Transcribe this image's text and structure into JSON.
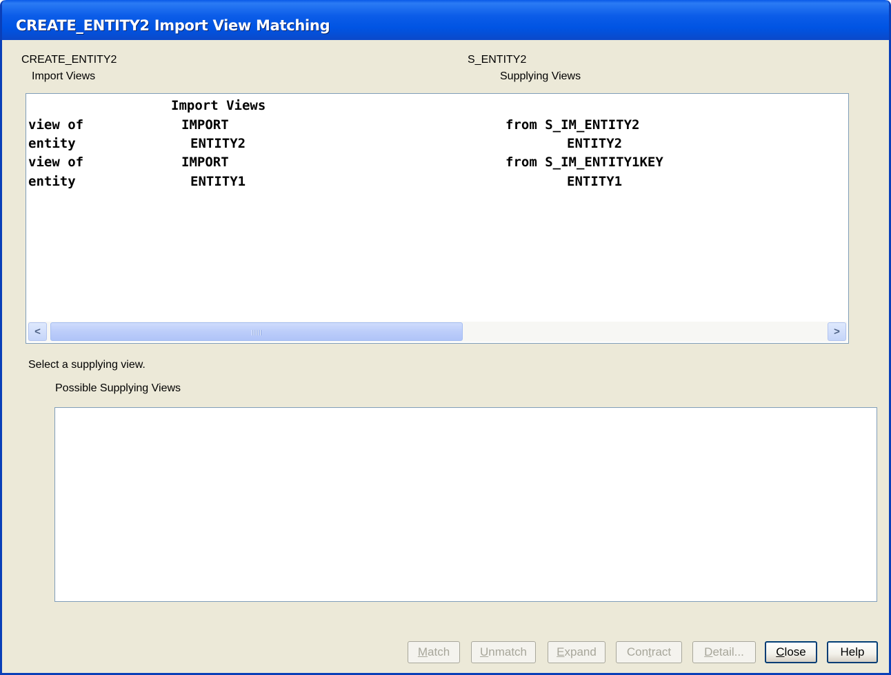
{
  "window": {
    "title": "CREATE_ENTITY2 Import View Matching"
  },
  "header": {
    "left_name": "CREATE_ENTITY2",
    "left_sub": "Import Views",
    "right_name": "S_ENTITY2",
    "right_sub": "Supplying Views"
  },
  "import_view": {
    "heading": "Import Views",
    "rows": [
      {
        "col1": "view of",
        "col2": "IMPORT",
        "col3": "from S_IM_ENTITY2"
      },
      {
        "col1": "entity",
        "col2": "ENTITY2",
        "col3": "ENTITY2"
      },
      {
        "col1": "view of",
        "col2": "IMPORT",
        "col3": "from S_IM_ENTITY1KEY"
      },
      {
        "col1": "entity",
        "col2": "ENTITY1",
        "col3": "ENTITY1"
      }
    ]
  },
  "instruction": "Select a supplying view.",
  "possible_label": "Possible Supplying Views",
  "possible_items": [],
  "buttons": [
    {
      "key": "M",
      "rest": "atch",
      "enabled": false
    },
    {
      "key": "U",
      "rest": "nmatch",
      "enabled": false
    },
    {
      "key": "E",
      "rest": "xpand",
      "enabled": false
    },
    {
      "pre": "Con",
      "key": "t",
      "rest": "ract",
      "enabled": false
    },
    {
      "key": "D",
      "rest": "etail...",
      "enabled": false
    },
    {
      "key": "C",
      "rest": "lose",
      "enabled": true
    },
    {
      "key": "",
      "rest": "Help",
      "enabled": true
    }
  ],
  "colors": {
    "titlebar": "#0054e3",
    "dialog_bg": "#ece9d8",
    "disabled_text": "#a7a69a"
  }
}
